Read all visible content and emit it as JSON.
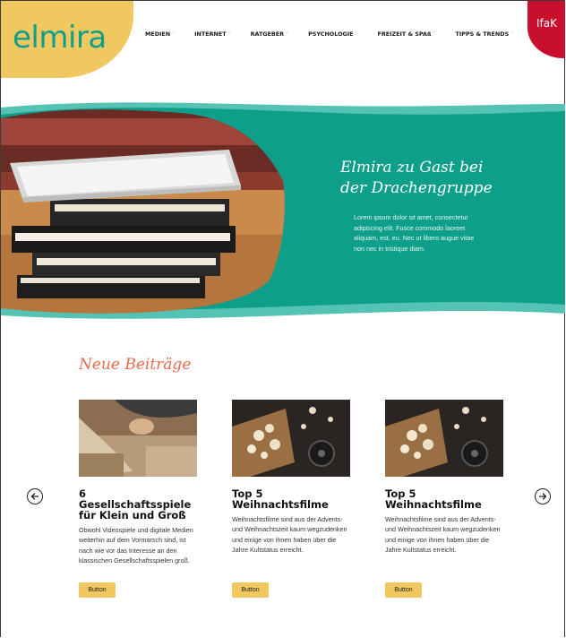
{
  "header": {
    "logo_text": "elmira",
    "nav": [
      {
        "label": "MEDIEN"
      },
      {
        "label": "INTERNET"
      },
      {
        "label": "RATGEBER"
      },
      {
        "label": "PSYCHOLOGIE"
      },
      {
        "label": "FREIZEIT & SPAß"
      },
      {
        "label": "TIPPS & TRENDS"
      }
    ],
    "chevron": "˅",
    "partner_logo_text": "IfaK"
  },
  "hero": {
    "title_line1": "Elmira zu Gast bei",
    "title_line2": "der Drachengruppe",
    "text": "Lorem ipsum dolor sit amet, consectetur adipiscing elit. Fusce commodo laoreet aliquam, est, eu. Nec ut libero augue vitae non nec in tristique diam."
  },
  "section": {
    "title": "Neue Beiträge",
    "cards": [
      {
        "title": "6 Gesellschaftsspiele für Klein und Groß",
        "text": "Obwohl Videospiele und digitale Medien weiterhin auf dem Vormarsch sind, ist nach wie vor das Interesse an den klassischen Gesellschaftsspielen groß.",
        "button": "Button"
      },
      {
        "title": "Top 5 Weihnachtsfilme",
        "text": "Weihnachtsfilme sind aus der Advents- und Weihnachtszeit kaum wegzudenken und einige von ihnen haben über die Jahre Kultstatus erreicht.",
        "button": "Button"
      },
      {
        "title": "Top 5 Weihnachtsfilme",
        "text": "Weihnachtsfilme sind aus der Advents- und Weihnachtszeit kaum wegzudenken und einige von ihnen haben über die Jahre Kultstatus erreicht.",
        "button": "Button"
      }
    ]
  },
  "colors": {
    "teal": "#0e9f8a",
    "yellow": "#f1c75f",
    "coral": "#e86b4e",
    "red": "#c8102e"
  }
}
